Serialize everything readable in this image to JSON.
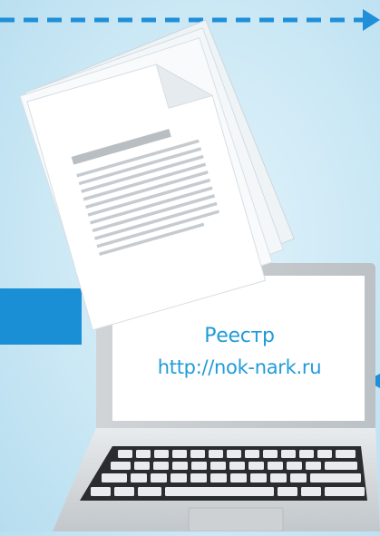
{
  "illustration": {
    "colors": {
      "background": "#cbe8f5",
      "accent_blue": "#1a8fd6",
      "dashed_line": "#1e8fd8",
      "laptop_body": "#d4d8db",
      "screen": "#ffffff",
      "text_blue": "#1f9bd8"
    },
    "icons": [
      "dashed-arrow-icon",
      "document-stack-icon",
      "laptop-icon",
      "small-arrow-icon"
    ],
    "screen": {
      "title": "Реестр",
      "url": "http://nok-nark.ru"
    }
  }
}
